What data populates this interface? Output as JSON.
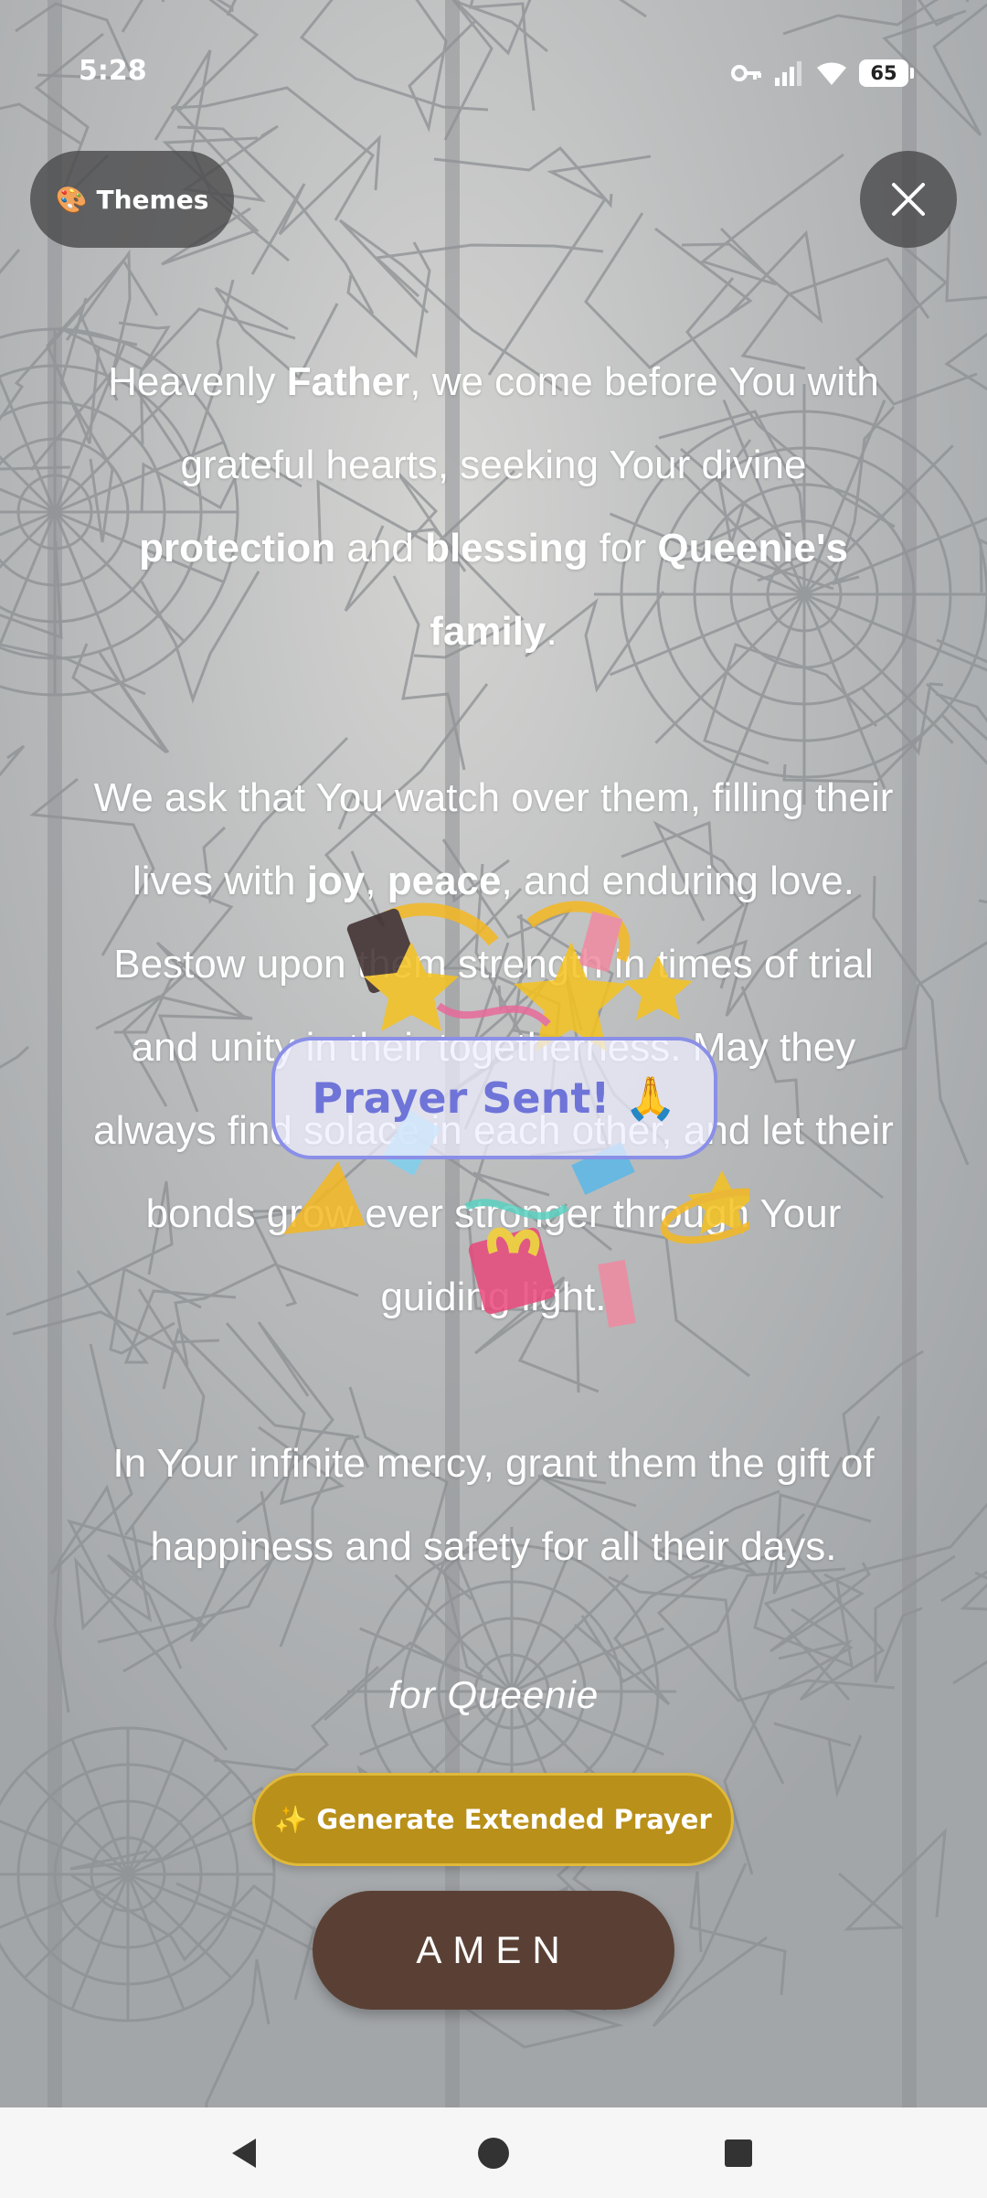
{
  "status_bar": {
    "time": "5:28",
    "battery": "65",
    "icons": [
      "vpn-key-icon",
      "signal-icon",
      "wifi-icon",
      "battery-icon"
    ]
  },
  "header": {
    "themes_emoji": "🎨",
    "themes_label": "Themes",
    "close_icon": "close-icon"
  },
  "prayer": {
    "paragraphs": [
      [
        {
          "t": "Heavenly ",
          "b": false
        },
        {
          "t": "Father",
          "b": true
        },
        {
          "t": ", we come before You with grateful hearts, seeking Your divine ",
          "b": false
        },
        {
          "t": "protection",
          "b": true
        },
        {
          "t": " and ",
          "b": false
        },
        {
          "t": "blessing",
          "b": true
        },
        {
          "t": " for ",
          "b": false
        },
        {
          "t": "Queenie's family",
          "b": true
        },
        {
          "t": ".",
          "b": false
        }
      ],
      [
        {
          "t": "We ask that You watch over them, filling their lives with ",
          "b": false
        },
        {
          "t": "joy",
          "b": true
        },
        {
          "t": ", ",
          "b": false
        },
        {
          "t": "peace",
          "b": true
        },
        {
          "t": ", and enduring love. Bestow upon them strength in times of trial and unity in their togetherness. May they always find solace in each other, and let their bonds grow ever stronger through Your guiding light.",
          "b": false
        }
      ],
      [
        {
          "t": "In Your infinite mercy, grant them the gift of happiness and safety for all their days.",
          "b": false
        }
      ]
    ],
    "for_line": "for Queenie"
  },
  "actions": {
    "generate_label": "✨ Generate Extended Prayer",
    "amen_label": "AMEN"
  },
  "overlay": {
    "toast": "Prayer Sent! 🙏",
    "accent_color": "#6f74d8"
  },
  "colors": {
    "generate_bg": "#b8901a",
    "amen_bg": "#5a4034"
  },
  "nav_bar": {
    "back_icon": "back-triangle-icon",
    "home_icon": "home-circle-icon",
    "recents_icon": "recents-square-icon"
  }
}
